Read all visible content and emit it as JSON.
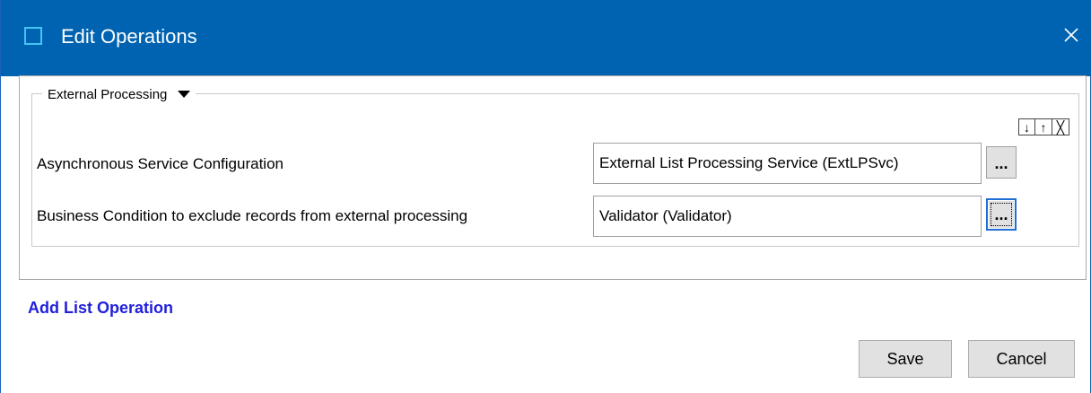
{
  "window": {
    "title": "Edit Operations"
  },
  "group": {
    "legend": "External Processing",
    "tools": [
      "↓",
      "↑",
      "╳"
    ]
  },
  "rows": [
    {
      "label": "Asynchronous Service Configuration",
      "value": "External List Processing Service (ExtLPSvc)",
      "button": "..."
    },
    {
      "label": "Business Condition to exclude records from external processing",
      "value": "Validator (Validator)",
      "button": "..."
    }
  ],
  "add_link": "Add List Operation",
  "buttons": {
    "save": "Save",
    "cancel": "Cancel"
  },
  "colors": {
    "titlebar": "#0063b1",
    "link": "#1f1fdc",
    "focus": "#1f6ed4"
  }
}
